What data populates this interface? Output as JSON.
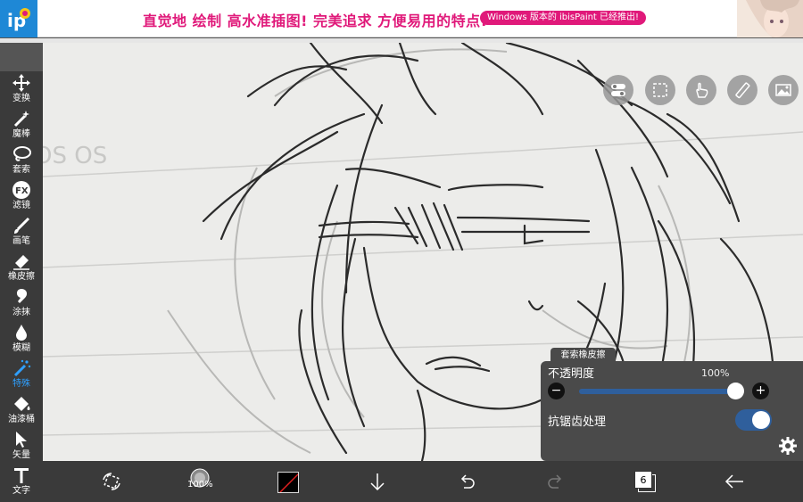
{
  "banner": {
    "headline": "直觉地 绘制 高水准插图! 完美追求 方便易用的特点!",
    "pill": "Windows 版本的 ibisPaint 已经推出!",
    "colors": {
      "accent": "#e0197a",
      "logo": "#1e88d6"
    }
  },
  "tools": [
    {
      "label": "变换",
      "icon": "move-icon"
    },
    {
      "label": "魔棒",
      "icon": "magic-wand-icon"
    },
    {
      "label": "套索",
      "icon": "lasso-icon"
    },
    {
      "label": "滤镜",
      "icon": "fx-icon"
    },
    {
      "label": "画笔",
      "icon": "brush-icon"
    },
    {
      "label": "橡皮擦",
      "icon": "eraser-icon"
    },
    {
      "label": "涂抹",
      "icon": "smudge-icon"
    },
    {
      "label": "模糊",
      "icon": "blur-icon"
    },
    {
      "label": "特殊",
      "icon": "special-icon",
      "active": true
    },
    {
      "label": "油漆桶",
      "icon": "bucket-icon"
    },
    {
      "label": "矢量",
      "icon": "vector-icon"
    },
    {
      "label": "文字",
      "icon": "text-icon"
    }
  ],
  "panel": {
    "tab_title": "套索橡皮擦",
    "opacity_label": "不透明度",
    "opacity_value": "100%",
    "opacity_fraction": 1.0,
    "antialias_label": "抗锯齿处理",
    "antialias_on": true,
    "minus": "−",
    "plus": "+"
  },
  "bottom": {
    "brush_size": "100%",
    "layers_count": "6"
  },
  "colors": {
    "toolbar": "#3a3a3a",
    "active_tool": "#2fa0ff",
    "toggle": "#2f5f9c"
  }
}
